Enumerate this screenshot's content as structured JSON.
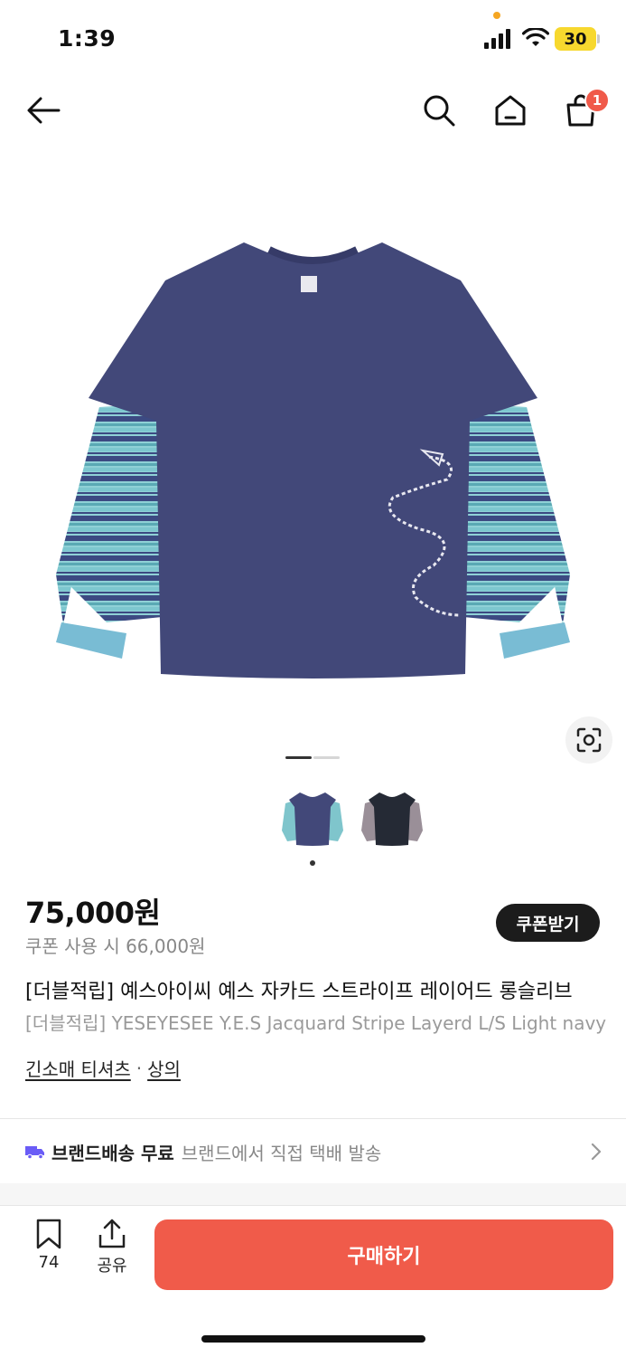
{
  "status": {
    "time": "1:39",
    "battery": "30"
  },
  "nav": {
    "cart_badge": "1"
  },
  "gallery": {
    "active_index": 1,
    "count": 2
  },
  "product": {
    "price": "75,000원",
    "coupon_price": "쿠폰 사용 시 66,000원",
    "coupon_button": "쿠폰받기",
    "title_ko": "[더블적립] 예스아이씨 예스 자카드 스트라이프 레이어드 롱슬리브",
    "title_en": "[더블적립] YESEYESEE Y.E.S Jacquard Stripe Layerd L/S Light navy",
    "category1": "긴소매 티셔츠",
    "category_sep": "·",
    "category2": "상의"
  },
  "shipping": {
    "label": "브랜드배송 무료",
    "sub": "브랜드에서 직접 택배 발송"
  },
  "bottom": {
    "bookmark_count": "74",
    "share_label": "공유",
    "buy_label": "구매하기"
  },
  "colors": {
    "accent": "#f05b4a",
    "shirt": "#41477d",
    "sleeve": "#7fc5cc",
    "coupon_btn": "#1c1c1c"
  }
}
